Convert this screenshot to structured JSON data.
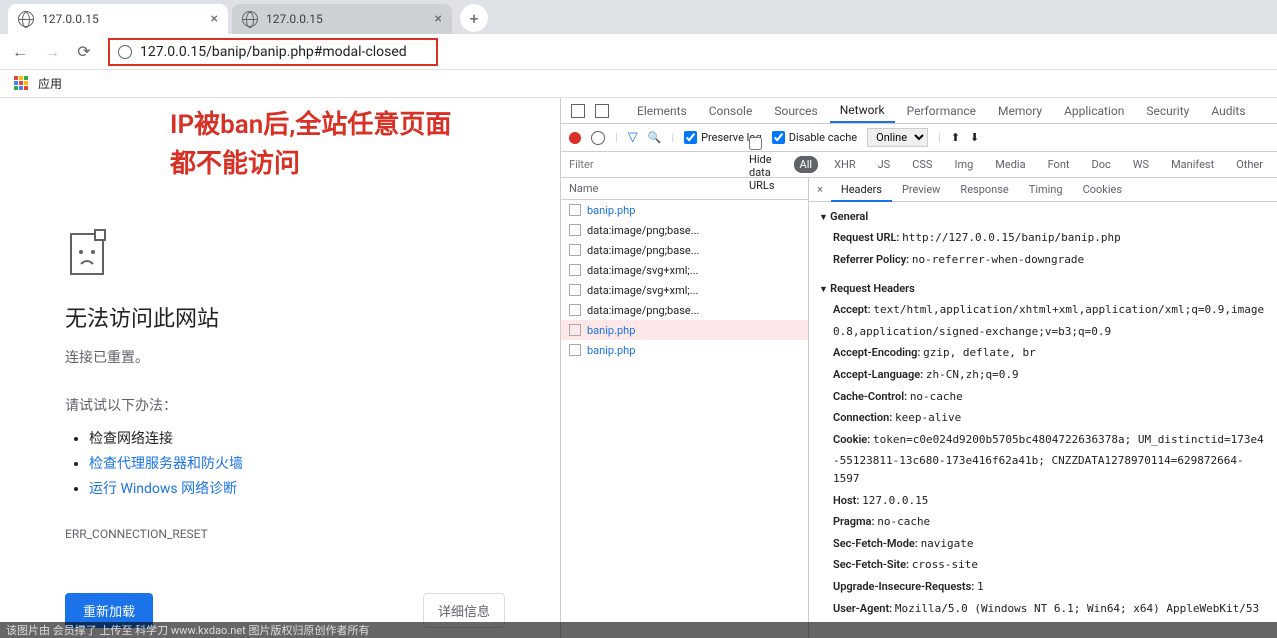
{
  "tabs": {
    "t0": "127.0.0.15",
    "t1": "127.0.0.15"
  },
  "addressbar": {
    "url": "127.0.0.15/banip/banip.php#modal-closed",
    "apps": "应用"
  },
  "annotation": {
    "line1": "IP被ban后,全站任意页面",
    "line2": "都不能访问"
  },
  "error": {
    "title": "无法访问此网站",
    "subtitle": "连接已重置。",
    "try": "请试试以下办法：",
    "sugg": [
      "检查网络连接",
      "检查代理服务器和防火墙",
      "运行 Windows 网络诊断"
    ],
    "code": "ERR_CONNECTION_RESET",
    "reload": "重新加载",
    "details": "详细信息"
  },
  "devtools": {
    "tabs": [
      "Elements",
      "Console",
      "Sources",
      "Network",
      "Performance",
      "Memory",
      "Application",
      "Security",
      "Audits"
    ],
    "bar": {
      "preserve": "Preserve log",
      "disable": "Disable cache",
      "online": "Online"
    },
    "filter": {
      "placeholder": "Filter",
      "hide": "Hide data URLs",
      "types": [
        "All",
        "XHR",
        "JS",
        "CSS",
        "Img",
        "Media",
        "Font",
        "Doc",
        "WS",
        "Manifest",
        "Other"
      ]
    },
    "namehdr": "Name",
    "requests": [
      "banip.php",
      "data:image/png;base...",
      "data:image/png;base...",
      "data:image/svg+xml;...",
      "data:image/svg+xml;...",
      "data:image/png;base...",
      "banip.php",
      "banip.php"
    ],
    "detailtabs": [
      "Headers",
      "Preview",
      "Response",
      "Timing",
      "Cookies"
    ],
    "general": {
      "hdr": "General",
      "url_k": "Request URL:",
      "url_v": "http://127.0.0.15/banip/banip.php",
      "ref_k": "Referrer Policy:",
      "ref_v": "no-referrer-when-downgrade"
    },
    "reqh": {
      "hdr": "Request Headers",
      "rows": [
        {
          "k": "Accept:",
          "v": "text/html,application/xhtml+xml,application/xml;q=0.9,image"
        },
        {
          "k": "",
          "v": "0.8,application/signed-exchange;v=b3;q=0.9"
        },
        {
          "k": "Accept-Encoding:",
          "v": "gzip, deflate, br"
        },
        {
          "k": "Accept-Language:",
          "v": "zh-CN,zh;q=0.9"
        },
        {
          "k": "Cache-Control:",
          "v": "no-cache"
        },
        {
          "k": "Connection:",
          "v": "keep-alive"
        },
        {
          "k": "Cookie:",
          "v": "token=c0e024d9200b5705bc4804722636378a; UM_distinctid=173e4"
        },
        {
          "k": "",
          "v": "-55123811-13c680-173e416f62a41b; CNZZDATA1278970114=629872664-1597"
        },
        {
          "k": "Host:",
          "v": "127.0.0.15"
        },
        {
          "k": "Pragma:",
          "v": "no-cache"
        },
        {
          "k": "Sec-Fetch-Mode:",
          "v": "navigate"
        },
        {
          "k": "Sec-Fetch-Site:",
          "v": "cross-site"
        },
        {
          "k": "Upgrade-Insecure-Requests:",
          "v": "1"
        },
        {
          "k": "User-Agent:",
          "v": "Mozilla/5.0 (Windows NT 6.1; Win64; x64) AppleWebKit/53"
        }
      ]
    }
  },
  "watermark": "该图片由 会员撑了 上传至 科学刀  www.kxdao.net  图片版权归原创作者所有"
}
